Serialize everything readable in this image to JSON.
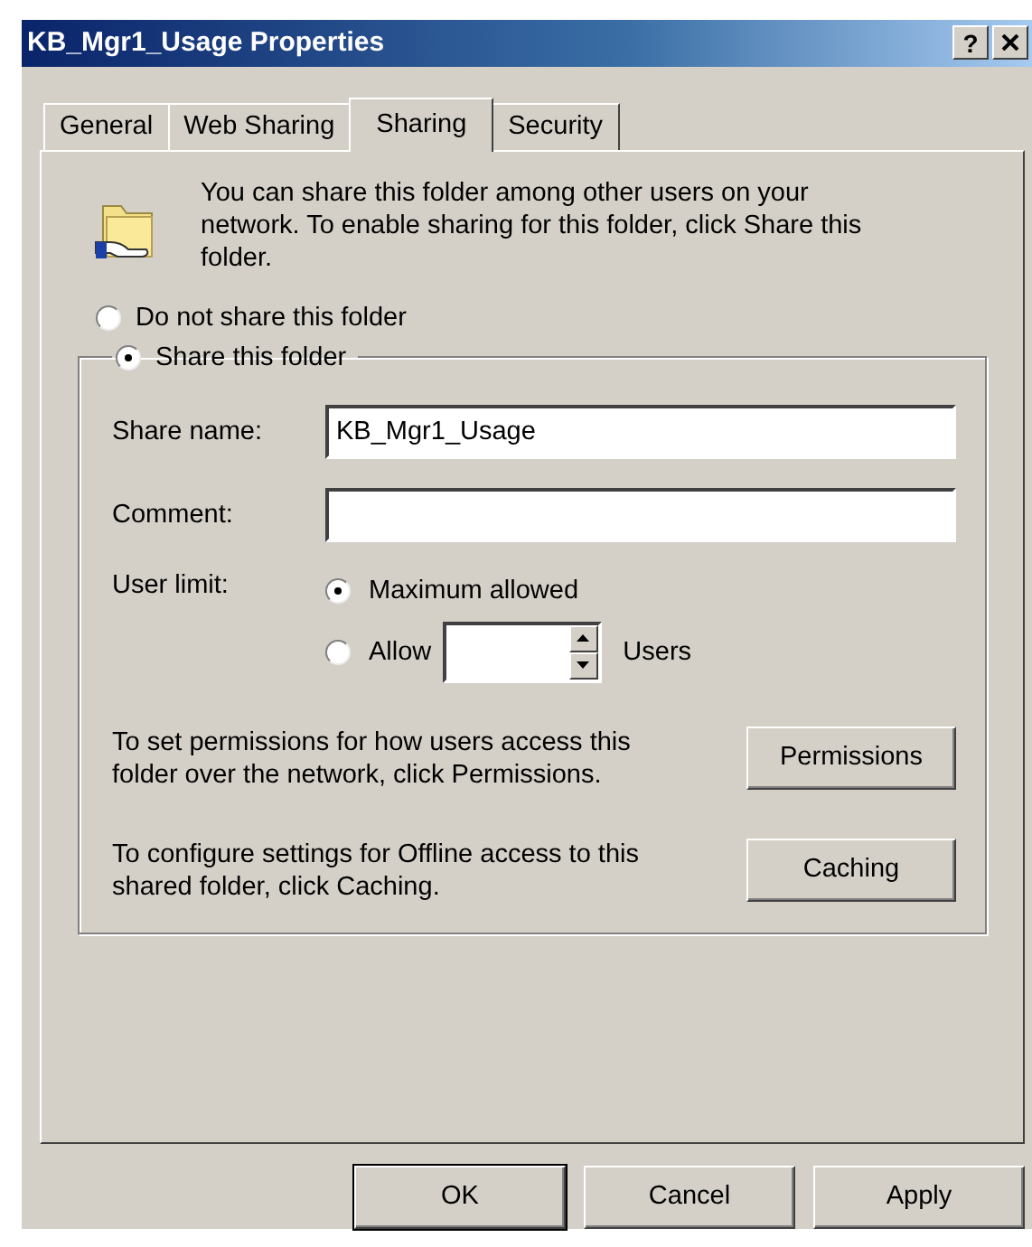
{
  "window": {
    "title": "KB_Mgr1_Usage Properties",
    "help_button": "?"
  },
  "tabs": [
    {
      "label": "General",
      "selected": false
    },
    {
      "label": "Web Sharing",
      "selected": false
    },
    {
      "label": "Sharing",
      "selected": true
    },
    {
      "label": "Security",
      "selected": false
    }
  ],
  "intro": "You can share this folder among other users on your network.  To enable sharing for this folder, click Share this folder.",
  "share_options": [
    {
      "label": "Do not share this folder",
      "selected": false
    },
    {
      "label": "Share this folder",
      "selected": true
    }
  ],
  "fields": [
    {
      "label": "Share name:",
      "value": "KB_Mgr1_Usage"
    },
    {
      "label": "Comment:"
    }
  ],
  "user_limit": {
    "label": "User limit:",
    "options": [
      {
        "kind": "plain",
        "label": "Maximum allowed",
        "selected": true
      },
      {
        "kind": "spinner",
        "label": "Allow",
        "selected": false,
        "suffix": "Users"
      }
    ]
  },
  "actions": [
    {
      "text": "To set permissions for how users access this folder over the network, click Permissions.",
      "button": "Permissions"
    },
    {
      "text": "To configure settings for Offline access to this shared folder, click Caching.",
      "button": "Caching"
    }
  ],
  "buttons": [
    {
      "label": "OK",
      "default": true
    },
    {
      "label": "Cancel",
      "default": false
    },
    {
      "label": "Apply",
      "default": false
    }
  ]
}
